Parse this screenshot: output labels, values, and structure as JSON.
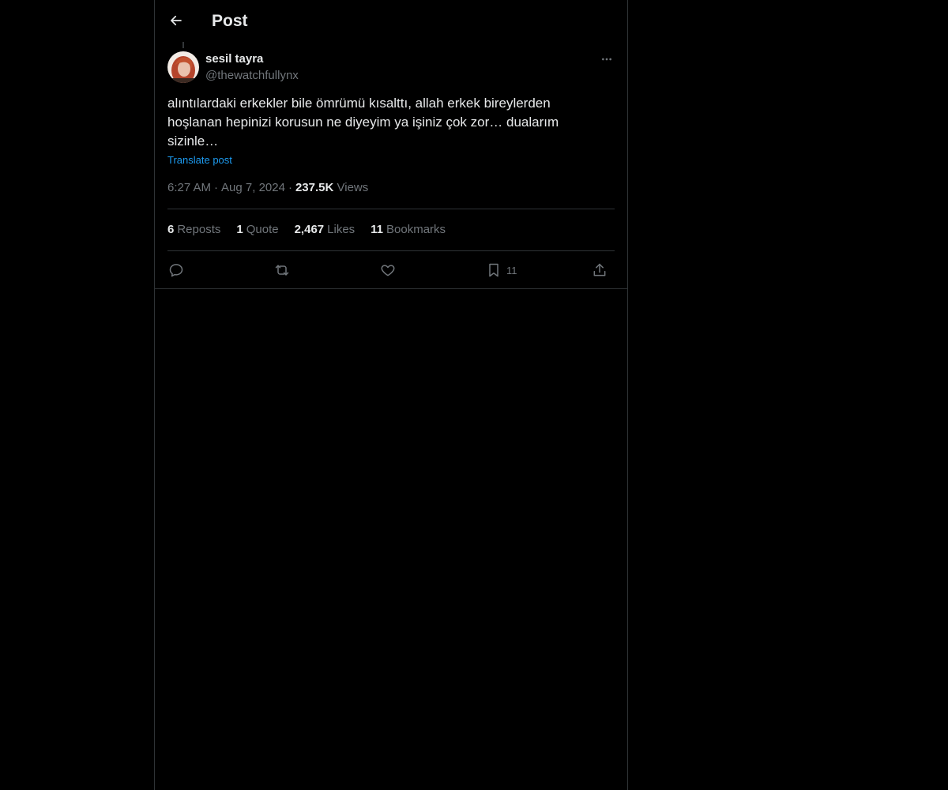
{
  "header": {
    "title": "Post",
    "back_icon": "arrow-left-icon"
  },
  "post": {
    "author": {
      "display_name": "sesil tayra",
      "handle": "@thewatchfullynx"
    },
    "text": "alıntılardaki erkekler bile ömrümü kısalttı, allah erkek bireylerden\nhoşlanan hepinizi korusun ne diyeyim ya işiniz çok zor… dualarım\nsizinle…",
    "translate_label": "Translate post",
    "time": "6:27 AM",
    "separator": "·",
    "date": "Aug 7, 2024",
    "views_count": "237.5K",
    "views_label": "Views"
  },
  "stats": {
    "reposts_count": "6",
    "reposts_label": "Reposts",
    "quotes_count": "1",
    "quotes_label": "Quote",
    "likes_count": "2,467",
    "likes_label": "Likes",
    "bookmarks_count": "11",
    "bookmarks_label": "Bookmarks"
  },
  "actions": {
    "reply_icon": "reply-icon",
    "repost_icon": "repost-icon",
    "like_icon": "heart-icon",
    "bookmark_icon": "bookmark-icon",
    "bookmark_count": "11",
    "share_icon": "share-icon"
  },
  "colors": {
    "background": "#000000",
    "text_primary": "#e7e9ea",
    "text_secondary": "#71767b",
    "link": "#1d9bf0",
    "border": "#2f3336"
  }
}
